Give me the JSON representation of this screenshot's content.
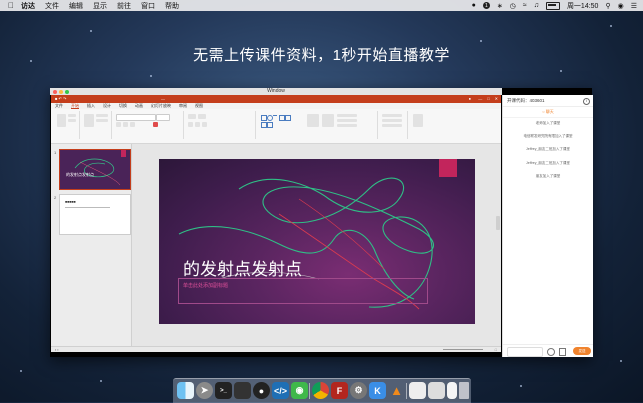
{
  "menubar": {
    "app": "访达",
    "items": [
      "文件",
      "编辑",
      "显示",
      "前往",
      "窗口",
      "帮助"
    ],
    "badge": "1",
    "clock": "周一14:50"
  },
  "headline": "无需上传课件资料，1秒开始直播教学",
  "window": {
    "title": "Window"
  },
  "ppt": {
    "tabs": [
      "文件",
      "开始",
      "插入",
      "设计",
      "切换",
      "动画",
      "幻灯片放映",
      "审阅",
      "视图"
    ],
    "slide": {
      "title": "的发射点发射点",
      "subtitle": "单击此处添加副标题"
    },
    "thumb1_title": "的发射点发射点",
    "thumb_numbers": [
      "1",
      "2"
    ]
  },
  "chat": {
    "code_label": "开课代码：403601",
    "tab_label": "聊天",
    "messages": [
      "老师加入了课堂",
      "电信联发研究院有限加入了课堂",
      "Jeffrey_朋友二班加入了课堂",
      "Jeffrey_朋友二班加入了课堂",
      "朋友加入了课堂"
    ],
    "send_label": "发送"
  },
  "colors": {
    "ppt_red": "#c43e1c",
    "slide_purple": "#4a2358",
    "accent_pink": "#c2255c",
    "chat_orange": "#f0832d"
  },
  "dock_icons": [
    "finder-icon",
    "launchpad-icon",
    "terminal-icon",
    "screen-icon",
    "qq-icon",
    "vscode-icon",
    "wechat-icon",
    "chrome-icon",
    "filezilla-icon",
    "settings-icon",
    "k-app-icon",
    "vlc-icon",
    "preview-icon",
    "photos-icon",
    "notes-icon",
    "trash-icon"
  ]
}
